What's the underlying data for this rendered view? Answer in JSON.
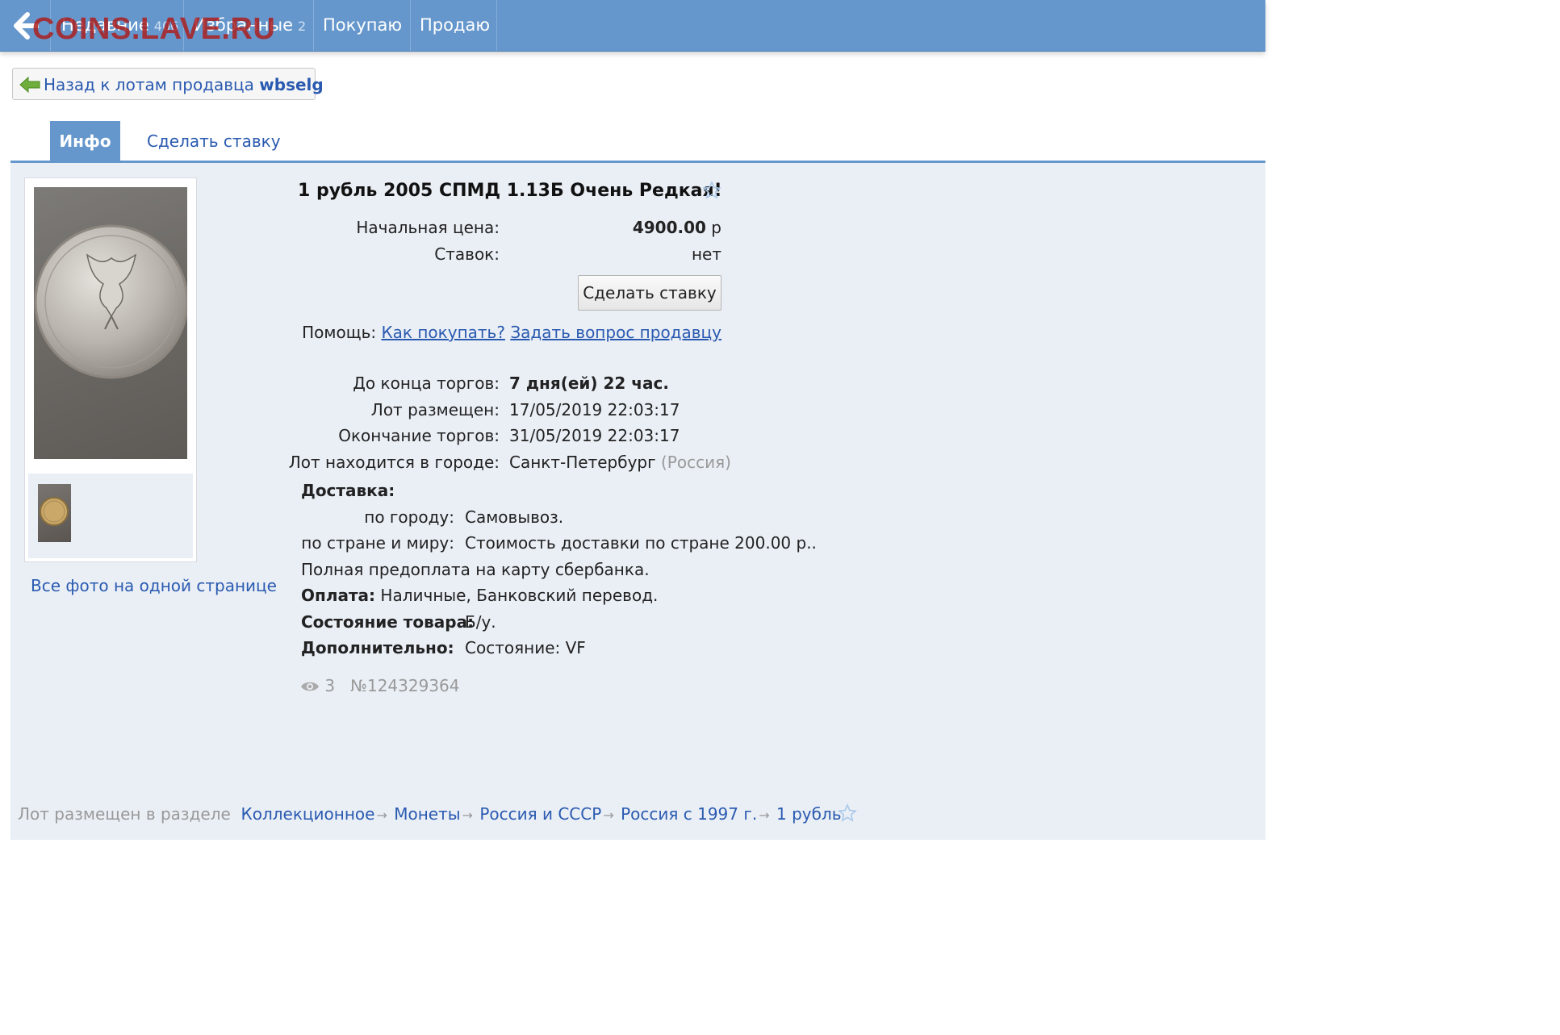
{
  "topbar": {
    "recent_label": "Недавние",
    "recent_count": "406",
    "favorites_label": "Избранные",
    "favorites_count": "2",
    "buying_label": "Покупаю",
    "selling_label": "Продаю",
    "watermark": "COINS.LAVE.RU"
  },
  "back": {
    "text": "Назад к лотам продавца",
    "seller": "wbselg"
  },
  "tabs": {
    "info": "Инфо",
    "bid": "Сделать ставку"
  },
  "gallery": {
    "all_photos_link": "Все фото на одной странице"
  },
  "lot": {
    "title": "1 рубль 2005 СПМД 1.13Б Очень Редкая!",
    "start_price_label": "Начальная цена:",
    "start_price": "4900.00",
    "currency": "р",
    "bids_label": "Ставок:",
    "bids": "нет",
    "bid_button": "Сделать ставку",
    "help_label": "Помощь:",
    "help_how": "Как покупать?",
    "help_ask": "Задать вопрос продавцу",
    "ends_in_label": "До конца торгов:",
    "ends_in": "7 дня(ей) 22 час.",
    "placed_label": "Лот размещен:",
    "placed": "17/05/2019 22:03:17",
    "end_label": "Окончание торгов:",
    "end": "31/05/2019 22:03:17",
    "city_label": "Лот находится в городе:",
    "city": "Санкт-Петербург",
    "country": "(Россия)",
    "delivery_label": "Доставка:",
    "delivery_city_label": "по городу:",
    "delivery_city": "Самовывоз.",
    "delivery_world_label": "по стране и миру:",
    "delivery_world": "Стоимость доставки по стране 200.00 р..",
    "prepay": "Полная предоплата на карту сбербанка.",
    "payment_label": "Оплата:",
    "payment": "Наличные, Банковский перевод.",
    "condition_label": "Состояние товара:",
    "condition": "Б/у.",
    "extra_label": "Дополнительно:",
    "extra": "Состояние: VF",
    "views": "3",
    "lot_number": "№124329364"
  },
  "breadcrumbs": {
    "prefix": "Лот размещен в разделе",
    "items": [
      "Коллекционное",
      "Монеты",
      "Россия и СССР",
      "Россия с 1997 г.",
      "1 рубль"
    ]
  },
  "colors": {
    "accent": "#6597cc",
    "link": "#2a5ab0",
    "panel": "#eaeff6"
  }
}
